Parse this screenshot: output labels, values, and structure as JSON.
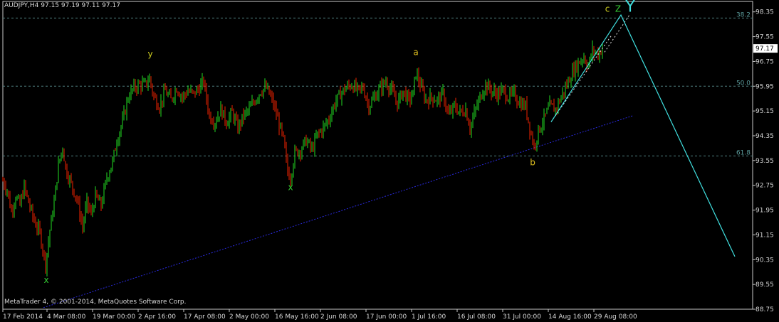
{
  "chart_data": {
    "type": "candlestick",
    "header": "AUDJPY,H4  97.15 97.19 97.11 97.17",
    "footer": "MetaTrader 4, © 2001-2014, MetaQuotes Software Corp.",
    "ylim": [
      88.75,
      98.55
    ],
    "y_ticks": [
      "98.35",
      "97.55",
      "96.75",
      "95.95",
      "95.15",
      "94.35",
      "93.55",
      "92.75",
      "91.95",
      "91.15",
      "90.35",
      "89.55",
      "88.75"
    ],
    "x_ticks": [
      "17 Feb 2014",
      "4 Mar 08:00",
      "19 Mar 00:00",
      "2 Apr 16:00",
      "17 Apr 08:00",
      "2 May 00:00",
      "16 May 16:00",
      "2 Jun 08:00",
      "17 Jun 00:00",
      "1 Jul 16:00",
      "16 Jul 08:00",
      "31 Jul 00:00",
      "14 Aug 16:00",
      "29 Aug 08:00"
    ],
    "current_price": "97.17",
    "fib_levels": [
      {
        "label": "38.2",
        "value": 98.15
      },
      {
        "label": "50.0",
        "value": 95.95
      },
      {
        "label": "61.8",
        "value": 93.7
      }
    ],
    "price_path": [
      {
        "t": 0,
        "v": 92.9
      },
      {
        "t": 6,
        "v": 92.6
      },
      {
        "t": 12,
        "v": 91.9
      },
      {
        "t": 18,
        "v": 92.4
      },
      {
        "t": 24,
        "v": 92.1
      },
      {
        "t": 30,
        "v": 92.7
      },
      {
        "t": 36,
        "v": 92.2
      },
      {
        "t": 44,
        "v": 91.6
      },
      {
        "t": 52,
        "v": 91.2
      },
      {
        "t": 60,
        "v": 90.2
      },
      {
        "t": 66,
        "v": 91.3
      },
      {
        "t": 72,
        "v": 92.2
      },
      {
        "t": 78,
        "v": 93.4
      },
      {
        "t": 84,
        "v": 94.0
      },
      {
        "t": 88,
        "v": 93.3
      },
      {
        "t": 96,
        "v": 92.8
      },
      {
        "t": 104,
        "v": 92.3
      },
      {
        "t": 112,
        "v": 91.4
      },
      {
        "t": 118,
        "v": 92.2
      },
      {
        "t": 124,
        "v": 91.8
      },
      {
        "t": 130,
        "v": 92.4
      },
      {
        "t": 138,
        "v": 92.1
      },
      {
        "t": 146,
        "v": 93.0
      },
      {
        "t": 154,
        "v": 93.5
      },
      {
        "t": 160,
        "v": 94.2
      },
      {
        "t": 168,
        "v": 94.8
      },
      {
        "t": 176,
        "v": 95.6
      },
      {
        "t": 184,
        "v": 95.9
      },
      {
        "t": 192,
        "v": 96.0
      },
      {
        "t": 200,
        "v": 96.0
      },
      {
        "t": 206,
        "v": 96.2
      },
      {
        "t": 212,
        "v": 95.6
      },
      {
        "t": 220,
        "v": 95.3
      },
      {
        "t": 228,
        "v": 95.8
      },
      {
        "t": 236,
        "v": 95.5
      },
      {
        "t": 244,
        "v": 95.9
      },
      {
        "t": 252,
        "v": 95.6
      },
      {
        "t": 260,
        "v": 95.8
      },
      {
        "t": 268,
        "v": 95.7
      },
      {
        "t": 276,
        "v": 95.9
      },
      {
        "t": 282,
        "v": 96.1
      },
      {
        "t": 290,
        "v": 95.0
      },
      {
        "t": 298,
        "v": 94.8
      },
      {
        "t": 306,
        "v": 95.2
      },
      {
        "t": 314,
        "v": 94.8
      },
      {
        "t": 322,
        "v": 95.1
      },
      {
        "t": 330,
        "v": 94.6
      },
      {
        "t": 338,
        "v": 95.0
      },
      {
        "t": 346,
        "v": 95.2
      },
      {
        "t": 354,
        "v": 95.5
      },
      {
        "t": 362,
        "v": 95.8
      },
      {
        "t": 370,
        "v": 95.9
      },
      {
        "t": 378,
        "v": 95.5
      },
      {
        "t": 386,
        "v": 94.9
      },
      {
        "t": 394,
        "v": 94.2
      },
      {
        "t": 400,
        "v": 93.2
      },
      {
        "t": 404,
        "v": 93.0
      },
      {
        "t": 410,
        "v": 93.8
      },
      {
        "t": 418,
        "v": 93.9
      },
      {
        "t": 426,
        "v": 94.2
      },
      {
        "t": 434,
        "v": 93.9
      },
      {
        "t": 442,
        "v": 94.4
      },
      {
        "t": 450,
        "v": 94.6
      },
      {
        "t": 458,
        "v": 94.9
      },
      {
        "t": 466,
        "v": 95.4
      },
      {
        "t": 474,
        "v": 95.7
      },
      {
        "t": 482,
        "v": 95.9
      },
      {
        "t": 490,
        "v": 96.0
      },
      {
        "t": 498,
        "v": 95.8
      },
      {
        "t": 506,
        "v": 95.9
      },
      {
        "t": 514,
        "v": 95.3
      },
      {
        "t": 522,
        "v": 95.6
      },
      {
        "t": 530,
        "v": 95.9
      },
      {
        "t": 538,
        "v": 96.1
      },
      {
        "t": 546,
        "v": 95.8
      },
      {
        "t": 554,
        "v": 95.4
      },
      {
        "t": 562,
        "v": 95.8
      },
      {
        "t": 570,
        "v": 95.5
      },
      {
        "t": 576,
        "v": 95.7
      },
      {
        "t": 580,
        "v": 96.4
      },
      {
        "t": 586,
        "v": 96.0
      },
      {
        "t": 594,
        "v": 95.5
      },
      {
        "t": 602,
        "v": 95.6
      },
      {
        "t": 610,
        "v": 95.5
      },
      {
        "t": 618,
        "v": 95.7
      },
      {
        "t": 626,
        "v": 95.0
      },
      {
        "t": 634,
        "v": 95.3
      },
      {
        "t": 642,
        "v": 95.1
      },
      {
        "t": 650,
        "v": 95.2
      },
      {
        "t": 656,
        "v": 94.6
      },
      {
        "t": 664,
        "v": 95.2
      },
      {
        "t": 672,
        "v": 95.7
      },
      {
        "t": 678,
        "v": 96.0
      },
      {
        "t": 686,
        "v": 95.8
      },
      {
        "t": 694,
        "v": 95.7
      },
      {
        "t": 702,
        "v": 95.8
      },
      {
        "t": 710,
        "v": 95.6
      },
      {
        "t": 718,
        "v": 95.7
      },
      {
        "t": 726,
        "v": 95.4
      },
      {
        "t": 734,
        "v": 95.3
      },
      {
        "t": 740,
        "v": 94.6
      },
      {
        "t": 746,
        "v": 94.0
      },
      {
        "t": 752,
        "v": 94.5
      },
      {
        "t": 760,
        "v": 94.9
      },
      {
        "t": 768,
        "v": 95.3
      },
      {
        "t": 776,
        "v": 95.2
      },
      {
        "t": 784,
        "v": 95.6
      },
      {
        "t": 792,
        "v": 96.0
      },
      {
        "t": 800,
        "v": 96.4
      },
      {
        "t": 808,
        "v": 96.7
      },
      {
        "t": 816,
        "v": 96.9
      },
      {
        "t": 822,
        "v": 96.6
      },
      {
        "t": 828,
        "v": 97.1
      },
      {
        "t": 836,
        "v": 97.0
      },
      {
        "t": 842,
        "v": 97.17
      }
    ],
    "support_line": {
      "start": {
        "t": 57,
        "v": 88.8
      },
      "end": {
        "t": 885,
        "v": 95.0
      },
      "color": "#2a2ae0"
    },
    "wave_projection": {
      "points": [
        {
          "t": 770,
          "v": 94.8
        },
        {
          "t": 868,
          "v": 98.25
        },
        {
          "t": 1028,
          "v": 90.45
        }
      ],
      "color": "#40e0e0"
    },
    "wave_dashed": [
      {
        "start": {
          "t": 770,
          "v": 94.8
        },
        "end": {
          "t": 855,
          "v": 97.6
        }
      },
      {
        "start": {
          "t": 845,
          "v": 97.05
        },
        "end": {
          "t": 880,
          "v": 98.25
        }
      }
    ],
    "wave_labels": [
      {
        "text": "x",
        "t": 61,
        "v": 89.6,
        "color": "#33cc33",
        "size": 12
      },
      {
        "text": "y",
        "t": 207,
        "v": 96.9,
        "color": "#d0d020",
        "size": 12
      },
      {
        "text": "x",
        "t": 404,
        "v": 92.6,
        "color": "#33cc33",
        "size": 12
      },
      {
        "text": "a",
        "t": 580,
        "v": 96.95,
        "color": "#e0c020",
        "size": 12
      },
      {
        "text": "b",
        "t": 744,
        "v": 93.4,
        "color": "#e0c020",
        "size": 12
      },
      {
        "text": "c",
        "t": 849,
        "v": 98.35,
        "color": "#d0d020",
        "size": 12
      },
      {
        "text": "Z",
        "t": 864,
        "v": 98.35,
        "color": "#33cc33",
        "size": 12
      },
      {
        "text": "Y",
        "t": 881,
        "v": 98.35,
        "color": "#40e0e0",
        "size": 22
      }
    ],
    "colors": {
      "bull": "#22dd22",
      "bear": "#ee2200",
      "grid": "#4f7f7f",
      "axis": "#c8c8c8",
      "text": "#d8d8d8"
    }
  }
}
